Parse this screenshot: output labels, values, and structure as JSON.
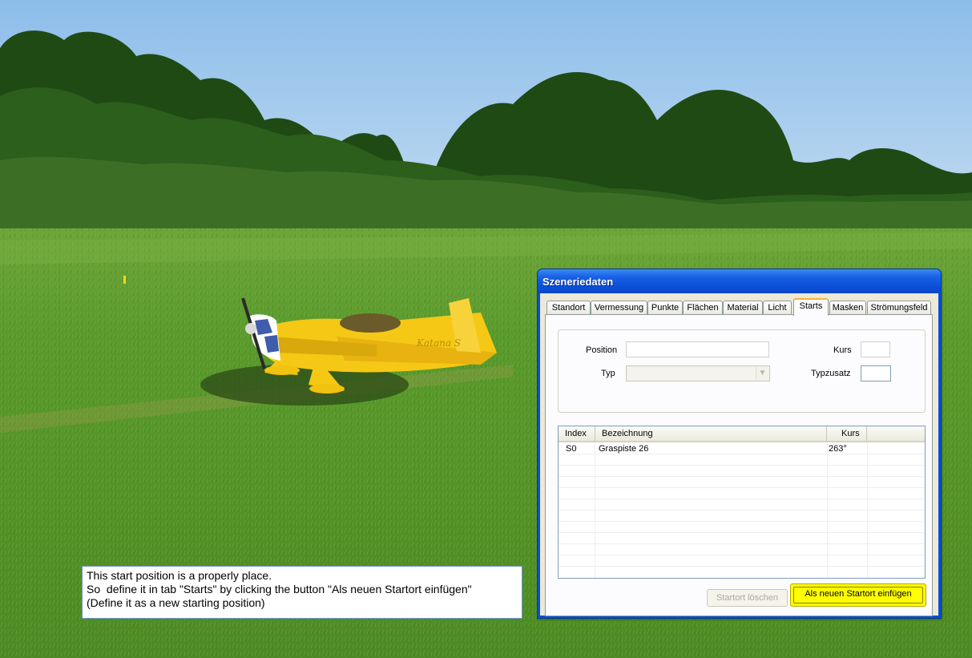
{
  "dialog": {
    "title": "Szeneriedaten",
    "tabs": [
      "Standort",
      "Vermessung",
      "Punkte",
      "Flächen",
      "Material",
      "Licht",
      "Starts",
      "Masken",
      "Strömungsfeld"
    ],
    "active_tab": "Starts",
    "form": {
      "position_label": "Position",
      "position_value": "",
      "typ_label": "Typ",
      "typ_value": "",
      "kurs_label": "Kurs",
      "kurs_value": "",
      "typzusatz_label": "Typzusatz",
      "typzusatz_value": ""
    },
    "list": {
      "columns": [
        "Index",
        "Bezeichnung",
        "Kurs"
      ],
      "rows": [
        {
          "index": "S0",
          "bezeichnung": "Graspiste 26",
          "kurs": "263°"
        }
      ]
    },
    "buttons": {
      "delete_label": "Startort löschen",
      "insert_label": "Als neuen Startort einfügen",
      "highlight_color": "#ffff00"
    }
  },
  "callout": {
    "lines": [
      "This start position is a properly place.",
      "So  define it in tab \"Starts\" by clicking the button \"Als neuen Startort einfügen\"",
      "(Define it as a new starting position)"
    ]
  },
  "scene": {
    "sky_color": "#9ec8ee",
    "grass_color": "#5f9a2c",
    "airplane_color": "#ffd21a",
    "airplane_decal": "Katana S"
  },
  "icons": {
    "combo_dropdown": "chevron-down-icon"
  }
}
